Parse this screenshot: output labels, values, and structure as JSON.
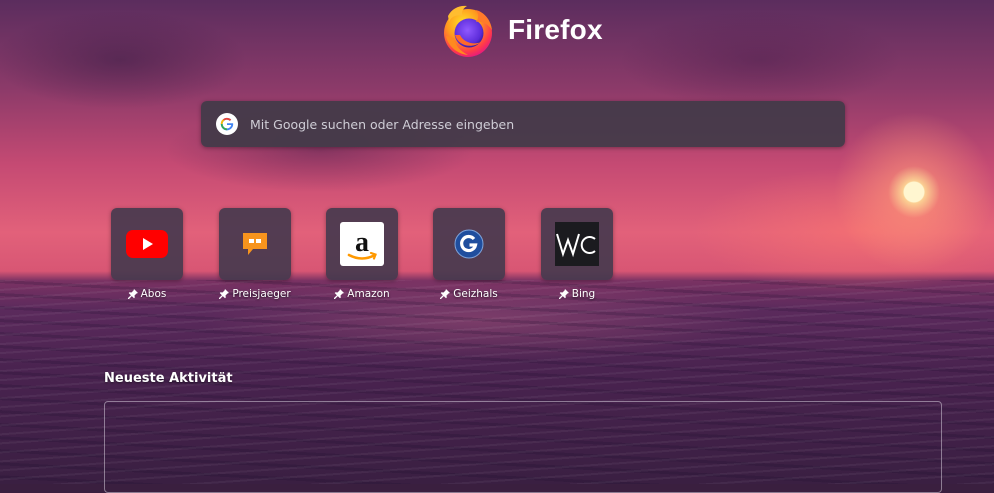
{
  "brand": {
    "name": "Firefox",
    "logo_icon": "firefox-logo-icon"
  },
  "search": {
    "placeholder": "Mit Google suchen oder Adresse eingeben",
    "value": "",
    "icon": "google-icon"
  },
  "top_sites": [
    {
      "label": "Abos",
      "icon": "youtube-icon",
      "pinned": true
    },
    {
      "label": "Preisjaeger",
      "icon": "preisjaeger-icon",
      "pinned": true
    },
    {
      "label": "Amazon",
      "icon": "amazon-icon",
      "pinned": true
    },
    {
      "label": "Geizhals",
      "icon": "geizhals-icon",
      "pinned": true
    },
    {
      "label": "Bing",
      "icon": "bing-icon",
      "pinned": true
    }
  ],
  "activity": {
    "title": "Neueste Aktivität"
  },
  "colors": {
    "youtube_red": "#ff0000",
    "preisjaeger_orange": "#f7941d",
    "amazon_orange": "#ff9900",
    "geizhals_blue": "#1f4e9e"
  }
}
